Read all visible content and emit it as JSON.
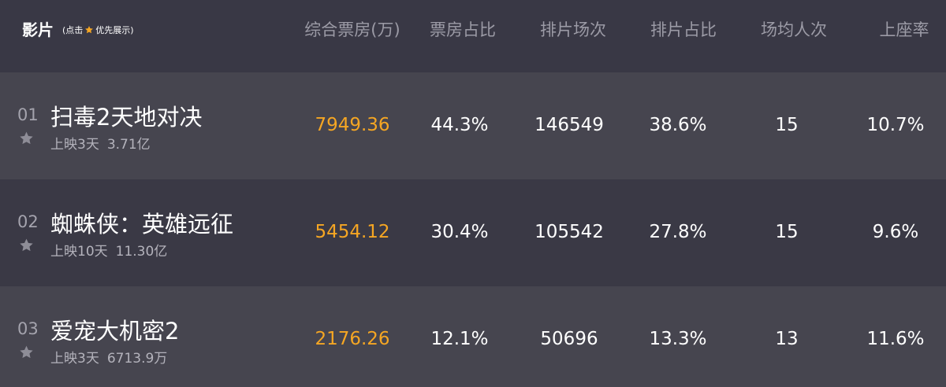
{
  "header": {
    "film_label": "影片",
    "hint_before": "(点击",
    "hint_after": "优先展示)",
    "columns": [
      "综合票房(万)",
      "票房占比",
      "排片场次",
      "排片占比",
      "场均人次",
      "上座率"
    ]
  },
  "colors": {
    "box_office": "#f5a623",
    "star_hint": "#f5a623",
    "star_row": "#8e8d97"
  },
  "icons": {
    "hint_star": "star-icon",
    "row_star": "star-icon"
  },
  "rows": [
    {
      "rank": "01",
      "title": "扫毒2天地对决",
      "days": "上映3天",
      "total": "3.71亿",
      "box_office": "7949.36",
      "box_share": "44.3%",
      "shows": "146549",
      "show_share": "38.6%",
      "avg_people": "15",
      "occupancy": "10.7%"
    },
    {
      "rank": "02",
      "title": "蜘蛛侠：英雄远征",
      "days": "上映10天",
      "total": "11.30亿",
      "box_office": "5454.12",
      "box_share": "30.4%",
      "shows": "105542",
      "show_share": "27.8%",
      "avg_people": "15",
      "occupancy": "9.6%"
    },
    {
      "rank": "03",
      "title": "爱宠大机密2",
      "days": "上映3天",
      "total": "6713.9万",
      "box_office": "2176.26",
      "box_share": "12.1%",
      "shows": "50696",
      "show_share": "13.3%",
      "avg_people": "13",
      "occupancy": "11.6%"
    }
  ]
}
